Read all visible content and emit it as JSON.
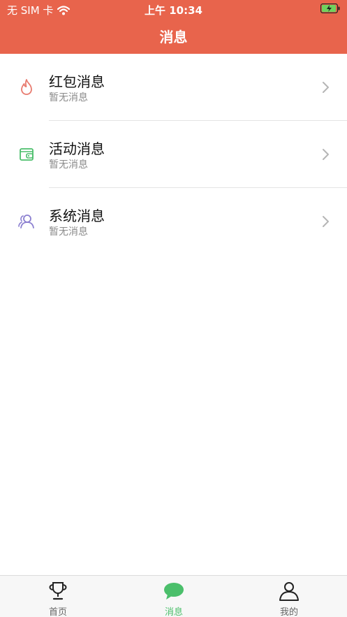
{
  "status": {
    "carrier": "无 SIM 卡",
    "time": "上午 10:34",
    "icons": [
      "wifi-icon",
      "battery-charging-icon"
    ]
  },
  "header": {
    "title": "消息"
  },
  "messages": [
    {
      "title": "红包消息",
      "subtitle": "暂无消息",
      "icon": "flame-icon",
      "color": "#e87a6e"
    },
    {
      "title": "活动消息",
      "subtitle": "暂无消息",
      "icon": "wallet-icon",
      "color": "#4bbf6b"
    },
    {
      "title": "系统消息",
      "subtitle": "暂无消息",
      "icon": "users-icon",
      "color": "#8b7fd0"
    }
  ],
  "tabs": [
    {
      "label": "首页",
      "icon": "trophy-icon",
      "active": false
    },
    {
      "label": "消息",
      "icon": "chat-bubble-icon",
      "active": true
    },
    {
      "label": "我的",
      "icon": "person-icon",
      "active": false
    }
  ],
  "colors": {
    "brand": "#e8644c",
    "active_tab": "#4bbf6b",
    "inactive_tab": "#666666"
  }
}
